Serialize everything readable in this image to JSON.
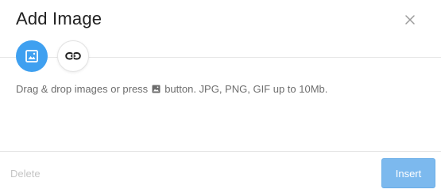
{
  "dialog": {
    "title": "Add Image",
    "close_icon": "close-icon"
  },
  "tabs": [
    {
      "name": "upload-image",
      "icon": "image-icon",
      "active": true
    },
    {
      "name": "by-url",
      "icon": "link-icon",
      "active": false
    }
  ],
  "instructions": {
    "before_icon": "Drag & drop images or press",
    "icon": "image-icon",
    "after_icon": "button. JPG, PNG, GIF up to 10Mb."
  },
  "footer": {
    "delete_label": "Delete",
    "insert_label": "Insert"
  },
  "colors": {
    "accent": "#3fa0f0",
    "insert_button": "#7cb9ee",
    "delete_text": "#c4c4c4"
  }
}
